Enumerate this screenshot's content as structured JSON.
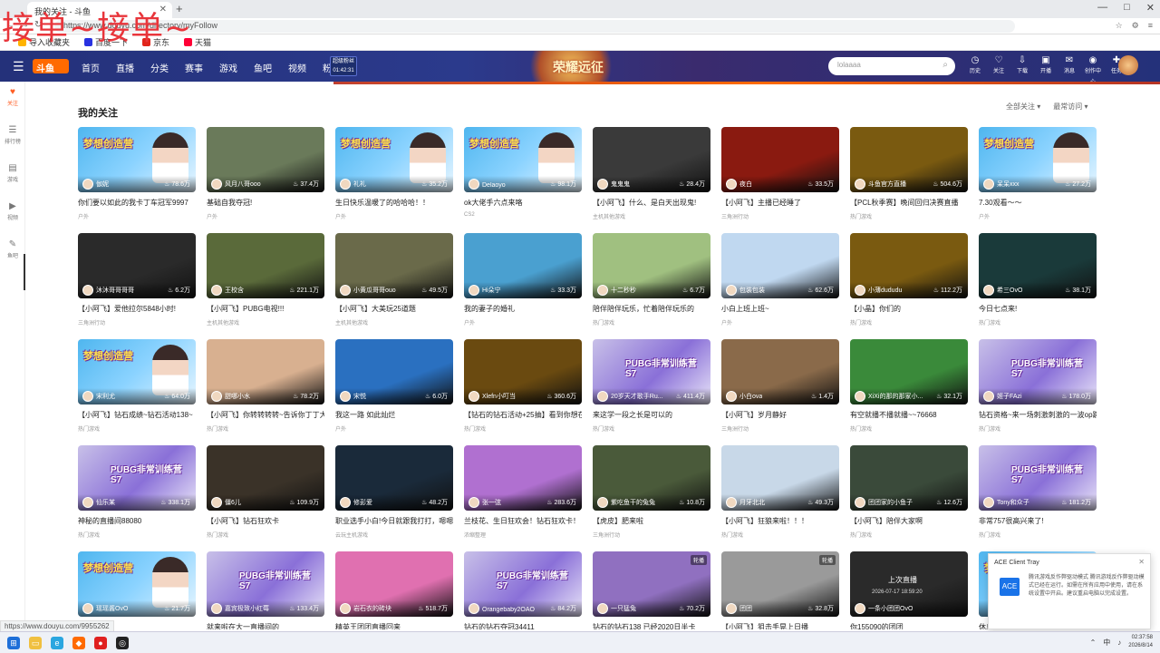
{
  "watermark": "接单~接单~",
  "browser": {
    "tab_title": "我的关注 - 斗鱼",
    "new_tab": "+",
    "address": "https://www.douyu.com/directory/myFollow",
    "window_controls": [
      "—",
      "□",
      "✕"
    ]
  },
  "bookmarks": [
    {
      "label": "导入收藏夹",
      "color": "#ffb300"
    },
    {
      "label": "百度一下",
      "color": "#2932e1"
    },
    {
      "label": "京东",
      "color": "#e1251b"
    },
    {
      "label": "天猫",
      "color": "#ff0036"
    }
  ],
  "header": {
    "logo": "斗鱼",
    "nav": [
      "首页",
      "直播",
      "分类",
      "赛事",
      "游戏",
      "鱼吧",
      "视频",
      "粉丝节"
    ],
    "promo": [
      "超级粉丝",
      "01:42:31"
    ],
    "banner": "荣耀远征",
    "search_placeholder": "lolaaaa",
    "icons": [
      {
        "name": "history-icon",
        "glyph": "◷",
        "label": "历史"
      },
      {
        "name": "follow-icon",
        "glyph": "♡",
        "label": "关注"
      },
      {
        "name": "download-icon",
        "glyph": "⇩",
        "label": "下载"
      },
      {
        "name": "broadcast-icon",
        "glyph": "▣",
        "label": "开播"
      },
      {
        "name": "message-icon",
        "glyph": "✉",
        "label": "消息"
      },
      {
        "name": "location-icon",
        "glyph": "◉",
        "label": "创作中心"
      },
      {
        "name": "task-icon",
        "glyph": "✚",
        "label": "任务"
      }
    ]
  },
  "sidebar": [
    {
      "name": "sidebar-item-follow",
      "glyph": "♥",
      "label": "关注",
      "active": true
    },
    {
      "name": "sidebar-item-ranking",
      "glyph": "☰",
      "label": "排行榜",
      "active": false
    },
    {
      "name": "sidebar-item-clip",
      "glyph": "▤",
      "label": "游戏",
      "active": false
    },
    {
      "name": "sidebar-item-video",
      "glyph": "▶",
      "label": "视频",
      "active": false
    },
    {
      "name": "sidebar-item-fish",
      "glyph": "✎",
      "label": "鱼吧",
      "active": false
    }
  ],
  "page": {
    "title": "我的关注",
    "filters": [
      "全部关注",
      "最常访问"
    ]
  },
  "cards": [
    {
      "title": "你们要以如此的我卡丁车冠军9997",
      "streamer": "伽妮",
      "heat": "78.6万",
      "category": "户外",
      "bg": "dream"
    },
    {
      "title": "基础自我夺冠!",
      "streamer": "风月八哥ooo",
      "heat": "37.4万",
      "category": "户外",
      "bg": "#6a7a5a"
    },
    {
      "title": "生日快乐温暖了的哈哈哈！！",
      "streamer": "礼礼",
      "heat": "35.2万",
      "category": "户外",
      "bg": "dream"
    },
    {
      "title": "ok大佬手六点来咯",
      "streamer": "Delaoyo",
      "heat": "98.1万",
      "category": "CS2",
      "bg": "dream"
    },
    {
      "title": "【小阿飞】什么、是白天出现鬼!",
      "streamer": "鬼鬼鬼",
      "heat": "28.4万",
      "category": "主机其他游戏",
      "bg": "#3a3a3a"
    },
    {
      "title": "【小阿飞】主播已经睡了",
      "streamer": "夜白",
      "heat": "33.5万",
      "category": "三角洲行动",
      "bg": "#8a1a10"
    },
    {
      "title": "【PCL秋季赛】晚间回归决赛直播",
      "streamer": "斗鱼官方直播",
      "heat": "504.6万",
      "category": "热门游戏",
      "bg": "#7a5a10"
    },
    {
      "title": "7.30观看～～",
      "streamer": "呆呆xxx",
      "heat": "27.2万",
      "category": "户外",
      "bg": "dream"
    },
    {
      "title": "【小阿飞】爱他拉尔5848小时!",
      "streamer": "沐沐哥哥哥哥",
      "heat": "6.2万",
      "category": "三角洲行动",
      "bg": "#2a2a2a"
    },
    {
      "title": "【小阿飞】PUBG电视!!!",
      "streamer": "王校含",
      "heat": "221.1万",
      "category": "主机其他游戏",
      "bg": "#5a6a3a"
    },
    {
      "title": "【小阿飞】大美玩25道题",
      "streamer": "小黄瓜哥哥ouo",
      "heat": "49.5万",
      "category": "主机其他游戏",
      "bg": "#6a6a4a"
    },
    {
      "title": "我的妻子的婚礼",
      "streamer": "Hi朵宁",
      "heat": "33.3万",
      "category": "户外",
      "bg": "#4aa0d0"
    },
    {
      "title": "陪伴陪伴玩乐，忙着陪伴玩乐的",
      "streamer": "十二秒秒",
      "heat": "6.7万",
      "category": "热门游戏",
      "bg": "#a0c080"
    },
    {
      "title": "小白上班上班~",
      "streamer": "包装包装",
      "heat": "62.6万",
      "category": "户外",
      "bg": "#c0d8f0"
    },
    {
      "title": "【小晶】你们的",
      "streamer": "小薄dududu",
      "heat": "112.2万",
      "category": "热门游戏",
      "bg": "#7a5a10"
    },
    {
      "title": "今日七点来!",
      "streamer": "希三OvO",
      "heat": "38.1万",
      "category": "热门游戏",
      "bg": "#1a3a3a"
    },
    {
      "title": "【小阿飞】钻石成绩~钻石活动138~",
      "streamer": "宋利尤",
      "heat": "64.0万",
      "category": "热门游戏",
      "bg": "dream"
    },
    {
      "title": "【小阿飞】你转转转转~告诉你丁丁大叔办",
      "streamer": "甜哪小水",
      "heat": "78.2万",
      "category": "热门游戏",
      "bg": "#d8b090"
    },
    {
      "title": "我这一路 如此灿烂",
      "streamer": "宋悦",
      "heat": "6.0万",
      "category": "户外",
      "bg": "#2a70c0"
    },
    {
      "title": "【钻石的钻石活动+25抽】看到你想在直播",
      "streamer": "Xlefn小叮当",
      "heat": "360.6万",
      "category": "热门游戏",
      "bg": "#6a4a10"
    },
    {
      "title": "来这学一段之长是可以的",
      "streamer": "20岁天才歌手Ru...",
      "heat": "411.4万",
      "category": "热门游戏",
      "bg": "pubg"
    },
    {
      "title": "【小阿飞】岁月静好",
      "streamer": "小白ova",
      "heat": "1.4万",
      "category": "三角洲行动",
      "bg": "#8a6a4a"
    },
    {
      "title": "有空就播不播就播~~76668",
      "streamer": "XiXi的那的那家小...",
      "heat": "32.1万",
      "category": "热门游戏",
      "bg": "#3a8a3a"
    },
    {
      "title": "钻石资格~来一场刺激刺激的一波op蹦",
      "streamer": "姬子FAzi",
      "heat": "178.0万",
      "category": "热门游戏",
      "bg": "pubg"
    },
    {
      "title": "神秘的直播间88080",
      "streamer": "仙乐某",
      "heat": "338.1万",
      "category": "热门游戏",
      "bg": "pubg"
    },
    {
      "title": "【小阿飞】钻石狂欢卡",
      "streamer": "僵6儿",
      "heat": "109.9万",
      "category": "热门游戏",
      "bg": "#3a3228"
    },
    {
      "title": "职业选手小白!今日就跟我打打，嗯嗯！",
      "streamer": "修彭爱",
      "heat": "48.2万",
      "category": "云玩主机游戏",
      "bg": "#1a2a3a"
    },
    {
      "title": "兰枝花、生日狂欢会！钻石狂欢卡！",
      "streamer": "张一弦",
      "heat": "283.6万",
      "category": "浓缩整理",
      "bg": "#b070d0"
    },
    {
      "title": "【虎皮】肥来啦",
      "streamer": "紫吃鱼干的兔兔",
      "heat": "10.8万",
      "category": "三角洲行动",
      "bg": "#4a5a3a"
    },
    {
      "title": "【小阿飞】狂狼来啦！！！",
      "streamer": "月牙北北",
      "heat": "49.3万",
      "category": "热门游戏",
      "bg": "#c8d8e8"
    },
    {
      "title": "【小阿飞】陪伴大家啊",
      "streamer": "团团家的小鱼子",
      "heat": "12.6万",
      "category": "热门游戏",
      "bg": "#3a4a3a"
    },
    {
      "title": "非常757很高兴来了!",
      "streamer": "Tony和众子",
      "heat": "181.2万",
      "category": "热门游戏",
      "bg": "pubg"
    },
    {
      "title": "我来啊～～",
      "streamer": "瑶瑶酱OvO",
      "heat": "21.7万",
      "category": "",
      "bg": "dream"
    },
    {
      "title": "就来啦在大一直播间的",
      "streamer": "嘉宾极致小红莓",
      "heat": "133.4万",
      "category": "",
      "bg": "pubg"
    },
    {
      "title": "精英王团团直播回来",
      "streamer": "岩石衣的砖块",
      "heat": "518.7万",
      "category": "",
      "bg": "#e070b0"
    },
    {
      "title": "钻石的钻石夺冠34411",
      "streamer": "Orangebaby2OAO",
      "heat": "84.2万",
      "category": "",
      "bg": "pubg"
    },
    {
      "title": "钻石的钻石138 已经2020日半卡",
      "streamer": "一只猛兔",
      "heat": "70.2万",
      "category": "",
      "bg": "#9070c0"
    },
    {
      "title": "【小阿飞】狙击手晃上日播",
      "streamer": "团团",
      "heat": "32.8万",
      "category": "",
      "bg": "#9a9a9a"
    },
    {
      "title": "你155090的团团",
      "streamer": "一条小团团OvO",
      "heat": "",
      "category": "",
      "bg": "#2a2a2a"
    },
    {
      "title": "休息～下班啦",
      "streamer": "",
      "heat": "",
      "category": "",
      "bg": "dream"
    }
  ],
  "thumb_text": {
    "dream": "梦想创造营",
    "pubg": "PUBG非常训练营S7",
    "replay_label": "上次直播",
    "replay_time": "2026-07-17 18:59:20",
    "tag_replay": "轮播"
  },
  "popup": {
    "title": "ACE Client Tray",
    "body": "腾讯游戏反作弊驱动模式 腾讯游戏反作弊驱动模式已经在运行。如需在所有应用中使用，请在系统设置中开启。建议重启电脑以完成设置。",
    "close": "✕",
    "icon_text": "ACE"
  },
  "status_url": "https://www.douyu.com/9955262",
  "taskbar": {
    "ime": "中",
    "time": "02:37:58",
    "date": "2026/8/14"
  }
}
